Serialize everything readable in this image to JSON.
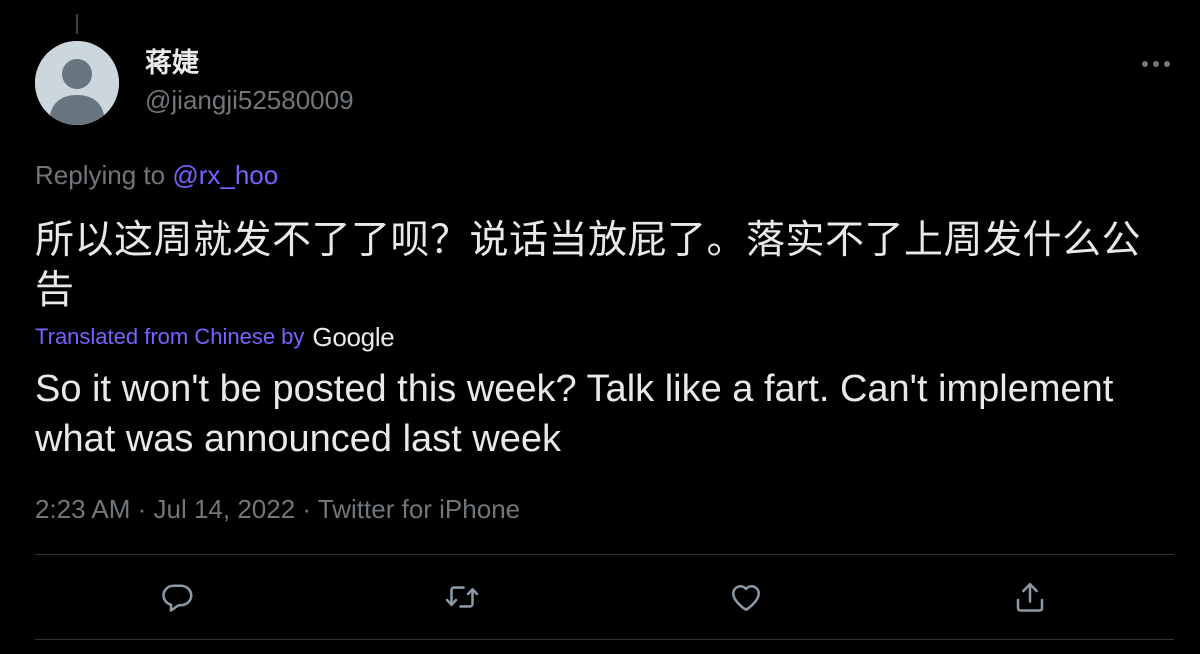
{
  "tweet": {
    "author": {
      "display_name": "蒋婕",
      "handle": "@jiangji52580009"
    },
    "replying": {
      "prefix": "Replying to",
      "mention": "@rx_hoo"
    },
    "text": "所以这周就发不了了呗？说话当放屁了。落实不了上周发什么公告",
    "translation": {
      "label": "Translated from Chinese by",
      "provider": "Google",
      "text": "So it won't be posted this week? Talk like a fart. Can't implement what was announced last week"
    },
    "meta": "2:23 AM · Jul 14, 2022 · Twitter for iPhone"
  },
  "icons": {
    "more": "more-horizontal-icon",
    "reply": "reply-icon",
    "retweet": "retweet-icon",
    "like": "heart-icon",
    "share": "share-icon"
  },
  "colors": {
    "background": "#000000",
    "text_primary": "#e7e9ea",
    "text_secondary": "#71767b",
    "accent": "#7b61ff",
    "divider": "#2f3336"
  }
}
